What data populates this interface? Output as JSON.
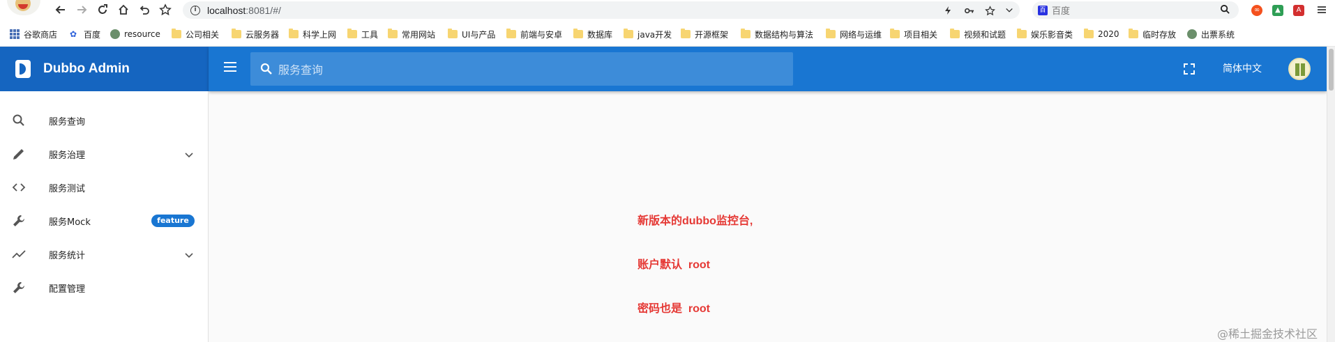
{
  "browser": {
    "url_host": "localhost",
    "url_path": ":8081/#/",
    "search_engine_label": "百度",
    "bookmarks": [
      {
        "icon": "apps-icon",
        "label": "谷歌商店"
      },
      {
        "icon": "baidu-paw-icon",
        "label": "百度"
      },
      {
        "icon": "globe-icon",
        "label": "resource"
      },
      {
        "icon": "folder-icon",
        "label": "公司相关"
      },
      {
        "icon": "folder-icon",
        "label": "云服务器"
      },
      {
        "icon": "folder-icon",
        "label": "科学上网"
      },
      {
        "icon": "folder-icon",
        "label": "工具"
      },
      {
        "icon": "folder-icon",
        "label": "常用网站"
      },
      {
        "icon": "folder-icon",
        "label": "UI与产品"
      },
      {
        "icon": "folder-icon",
        "label": "前端与安卓"
      },
      {
        "icon": "folder-icon",
        "label": "数据库"
      },
      {
        "icon": "folder-icon",
        "label": "java开发"
      },
      {
        "icon": "folder-icon",
        "label": "开源框架"
      },
      {
        "icon": "folder-icon",
        "label": "数据结构与算法"
      },
      {
        "icon": "folder-icon",
        "label": "网络与运维"
      },
      {
        "icon": "folder-icon",
        "label": "项目相关"
      },
      {
        "icon": "folder-icon",
        "label": "视频和试题"
      },
      {
        "icon": "folder-icon",
        "label": "娱乐影音类"
      },
      {
        "icon": "folder-icon",
        "label": "2020"
      },
      {
        "icon": "folder-icon",
        "label": "临时存放"
      },
      {
        "icon": "globe-icon",
        "label": "出票系统"
      }
    ]
  },
  "app": {
    "brand": "Dubbo Admin",
    "search_placeholder": "服务查询",
    "language": "简体中文",
    "primary_color": "#1976d2",
    "brand_color": "#1565c0",
    "sidebar": [
      {
        "icon": "search-icon",
        "label": "服务查询",
        "expandable": false
      },
      {
        "icon": "pencil-icon",
        "label": "服务治理",
        "expandable": true
      },
      {
        "icon": "code-icon",
        "label": "服务测试",
        "expandable": false
      },
      {
        "icon": "wrench-icon",
        "label": "服务Mock",
        "expandable": false,
        "badge": "feature"
      },
      {
        "icon": "trending-icon",
        "label": "服务统计",
        "expandable": true
      },
      {
        "icon": "wrench-icon",
        "label": "配置管理",
        "expandable": false
      }
    ]
  },
  "annotation": {
    "lines": [
      "新版本的dubbo监控台,",
      "账户默认  root",
      "密码也是  root"
    ],
    "color": "#e53935"
  },
  "watermark": "@稀土掘金技术社区"
}
